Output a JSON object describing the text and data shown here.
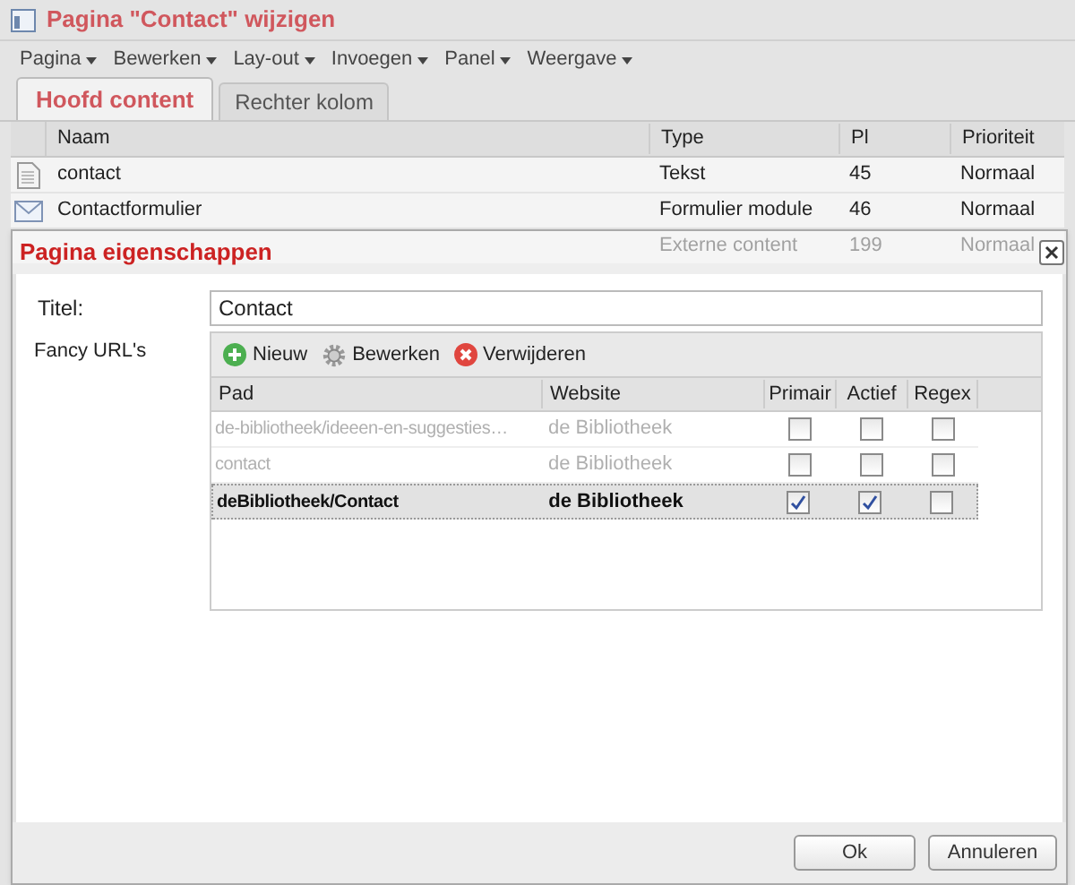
{
  "window": {
    "title": "Pagina \"Contact\" wijzigen"
  },
  "menu": [
    {
      "label": "Pagina"
    },
    {
      "label": "Bewerken"
    },
    {
      "label": "Lay-out"
    },
    {
      "label": "Invoegen"
    },
    {
      "label": "Panel"
    },
    {
      "label": "Weergave"
    }
  ],
  "tabs": [
    {
      "label": "Hoofd content",
      "selected": true
    },
    {
      "label": "Rechter kolom",
      "selected": false
    }
  ],
  "table": {
    "columns": [
      "Naam",
      "Type",
      "Pl",
      "Prioriteit"
    ],
    "rows": [
      {
        "kind": "page",
        "naam": "contact",
        "type": "Tekst",
        "pl": "45",
        "prioriteit": "Normaal"
      },
      {
        "kind": "mail",
        "naam": "Contactformulier",
        "type": "Formulier module",
        "pl": "46",
        "prioriteit": "Normaal"
      },
      {
        "kind": "hidden",
        "naam": "",
        "type": "Externe content",
        "pl": "199",
        "prioriteit": "Normaal"
      }
    ]
  },
  "dialog": {
    "title": "Pagina eigenschappen",
    "titel_label": "Titel:",
    "titel_value": "Contact",
    "fancy_label": "Fancy URL's",
    "toolbar": [
      {
        "kind": "add",
        "label": "Nieuw"
      },
      {
        "kind": "edit",
        "label": "Bewerken"
      },
      {
        "kind": "delete",
        "label": "Verwijderen"
      }
    ],
    "columns": [
      "Pad",
      "Website",
      "Primair",
      "Actief",
      "Regex"
    ],
    "rows": [
      {
        "pad": "de-bibliotheek/ideeen-en-suggesties…",
        "website": "de Bibliotheek",
        "primair": false,
        "actief": false,
        "regex": false,
        "selected": false
      },
      {
        "pad": "contact",
        "website": "de Bibliotheek",
        "primair": false,
        "actief": false,
        "regex": false,
        "selected": false
      },
      {
        "pad": "deBibliotheek/Contact",
        "website": "de Bibliotheek",
        "primair": true,
        "actief": true,
        "regex": false,
        "selected": true
      }
    ],
    "buttons": [
      "Ok",
      "Annuleren"
    ]
  }
}
